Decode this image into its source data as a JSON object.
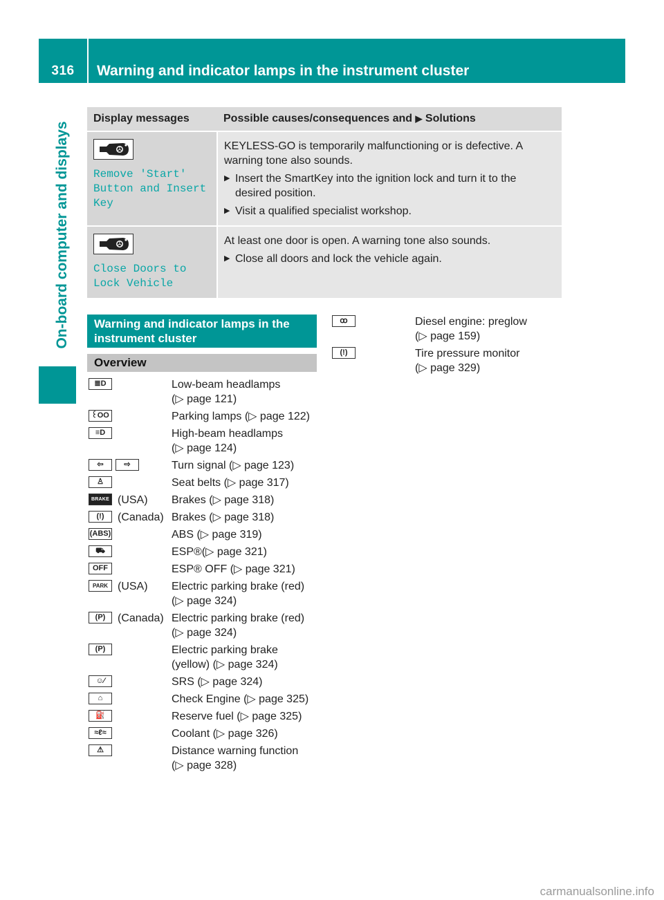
{
  "header": {
    "page_number": "316",
    "title": "Warning and indicator lamps in the instrument cluster"
  },
  "side_tab": {
    "label": "On-board computer and displays"
  },
  "colors": {
    "accent": "#009696",
    "display_text": "#0aa6a6",
    "header_gray": "#dadada",
    "cell_gray": "#e6e6e6"
  },
  "message_table": {
    "headers": [
      "Display messages",
      "Possible causes/consequences and",
      "Solutions"
    ],
    "rows": [
      {
        "icon": "smartkey-icon",
        "message": "Remove 'Start'\nButton and Insert\nKey",
        "cause": "KEYLESS-GO is temporarily malfunctioning or is defective. A warning tone also sounds.",
        "steps": [
          "Insert the SmartKey into the ignition lock and turn it to the desired position.",
          "Visit a qualified specialist workshop."
        ]
      },
      {
        "icon": "smartkey-icon",
        "message": "Close Doors to\nLock Vehicle",
        "cause": "At least one door is open. A warning tone also sounds.",
        "steps": [
          "Close all doors and lock the vehicle again."
        ]
      }
    ]
  },
  "section": {
    "title": "Warning and indicator lamps in the instrument cluster",
    "subtitle": "Overview"
  },
  "lamps_left": [
    {
      "icon": "low-beam-icon",
      "glyph": "≣D",
      "region": "",
      "desc": "Low-beam headlamps",
      "ref": "(▷ page 121)"
    },
    {
      "icon": "parking-lamps-icon",
      "glyph": "꒰OO꒱",
      "region": "",
      "desc": "Parking lamps (▷ page 122)",
      "ref": ""
    },
    {
      "icon": "high-beam-icon",
      "glyph": "≡D",
      "region": "",
      "desc": "High-beam headlamps",
      "ref": "(▷ page 124)"
    },
    {
      "icon": "turn-signal-icon",
      "glyph": "⇦|⇨",
      "region": "",
      "desc": "Turn signal (▷ page 123)",
      "ref": ""
    },
    {
      "icon": "seat-belt-icon",
      "glyph": "♙",
      "region": "",
      "desc": "Seat belts (▷ page 317)",
      "ref": ""
    },
    {
      "icon": "brake-text-icon",
      "glyph": "BRAKE",
      "region": "(USA)",
      "desc": "Brakes (▷ page 318)",
      "ref": ""
    },
    {
      "icon": "brake-circle-icon",
      "glyph": "(!)",
      "region": "(Canada)",
      "desc": "Brakes (▷ page 318)",
      "ref": ""
    },
    {
      "icon": "abs-icon",
      "glyph": "(ABS)",
      "region": "",
      "desc": "ABS (▷ page 319)",
      "ref": ""
    },
    {
      "icon": "esp-icon",
      "glyph": "⛟",
      "region": "",
      "desc": "ESP®(▷ page 321)",
      "ref": ""
    },
    {
      "icon": "esp-off-icon",
      "glyph": "OFF",
      "region": "",
      "desc": "ESP® OFF (▷ page 321)",
      "ref": ""
    },
    {
      "icon": "park-text-icon",
      "glyph": "PARK",
      "region": "(USA)",
      "desc": "Electric parking brake (red)",
      "ref": "(▷ page 324)"
    },
    {
      "icon": "parking-brake-circle-icon",
      "glyph": "(P)",
      "region": "(Canada)",
      "desc": "Electric parking brake (red)",
      "ref": "(▷ page 324)"
    },
    {
      "icon": "parking-brake-yellow-icon",
      "glyph": "(P)",
      "region": "",
      "desc": "Electric parking brake",
      "ref": "(yellow) (▷ page 324)"
    },
    {
      "icon": "srs-icon",
      "glyph": "☺⁄",
      "region": "",
      "desc": "SRS (▷ page 324)",
      "ref": ""
    },
    {
      "icon": "check-engine-icon",
      "glyph": "⌂",
      "region": "",
      "desc": "Check Engine (▷ page 325)",
      "ref": ""
    },
    {
      "icon": "reserve-fuel-icon",
      "glyph": "⛽",
      "region": "",
      "desc": "Reserve fuel (▷ page 325)",
      "ref": ""
    },
    {
      "icon": "coolant-icon",
      "glyph": "≈ℓ≈",
      "region": "",
      "desc": "Coolant (▷ page 326)",
      "ref": ""
    },
    {
      "icon": "distance-warning-icon",
      "glyph": "⚠",
      "region": "",
      "desc": "Distance warning function",
      "ref": "(▷ page 328)"
    }
  ],
  "lamps_right": [
    {
      "icon": "preglow-icon",
      "glyph": "ꝏ",
      "region": "",
      "desc": "Diesel engine: preglow",
      "ref": "(▷ page 159)"
    },
    {
      "icon": "tire-pressure-icon",
      "glyph": "(!)",
      "region": "",
      "desc": "Tire pressure monitor",
      "ref": "(▷ page 329)"
    }
  ],
  "watermark": "carmanualsonline.info"
}
